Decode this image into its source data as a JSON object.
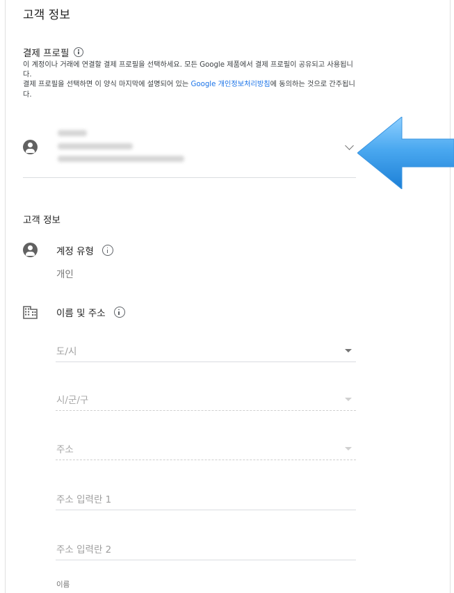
{
  "page_title": "고객 정보",
  "billing_profile": {
    "heading": "결제 프로필",
    "description_line1": "이 계정이나 거래에 연결할 결제 프로필을 선택하세요. 모든 Google 제품에서 결제 프로필이 공유되고 사용됩니다.",
    "description_line2_before": "결제 프로필을 선택하면 이 양식 마지막에 설명되어 있는 ",
    "privacy_link": "Google 개인정보처리방침",
    "description_line2_after": "에 동의하는 것으로 간주됩니다."
  },
  "customer_info": {
    "section_title": "고객 정보",
    "account_type_label": "계정 유형",
    "account_type_value": "개인",
    "name_address_label": "이름 및 주소",
    "fields": {
      "province": "도/시",
      "city": "시/군/구",
      "address": "주소",
      "address_line1": "주소 입력란 1",
      "address_line2": "주소 입력란 2"
    },
    "name_label": "이름"
  },
  "colors": {
    "link": "#1a73e8",
    "arrow": "#4aa8f0",
    "icon": "#616161"
  },
  "icons": [
    "info-icon",
    "person-icon",
    "chevron-down-icon",
    "building-icon",
    "dropdown-arrow-icon",
    "pointer-arrow-icon"
  ]
}
